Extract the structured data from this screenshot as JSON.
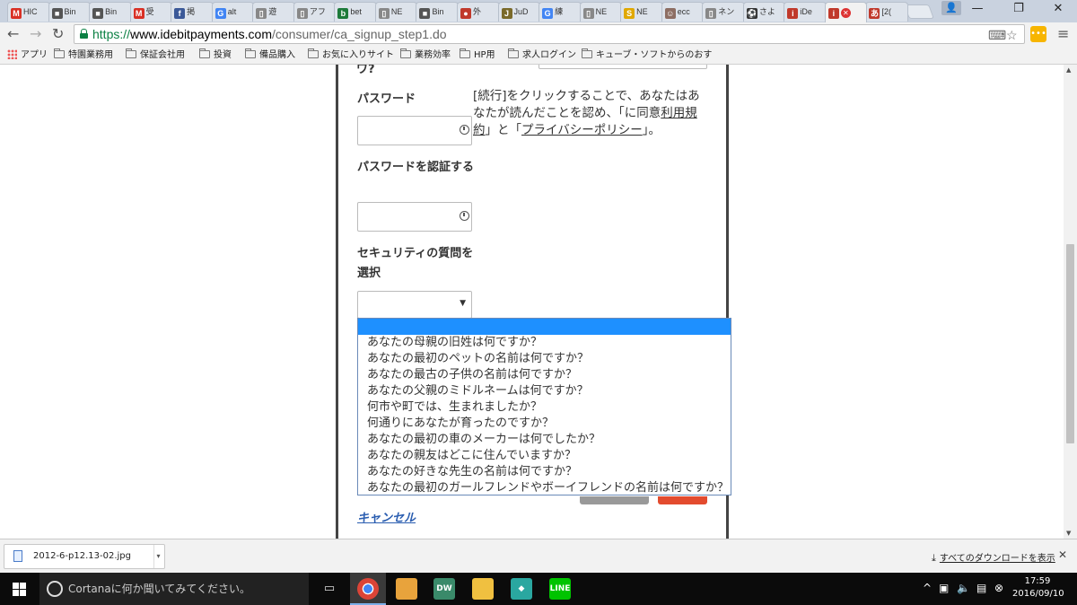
{
  "tabs": [
    {
      "label": "HIC",
      "icon": "gmail-icon",
      "color": "#d93025",
      "glyph": "M"
    },
    {
      "label": "Bin",
      "icon": "binary-icon",
      "color": "#555555",
      "glyph": "■"
    },
    {
      "label": "Bin",
      "icon": "binary-icon",
      "color": "#555555",
      "glyph": "■"
    },
    {
      "label": "受",
      "icon": "gmail-icon",
      "color": "#d93025",
      "glyph": "M"
    },
    {
      "label": "掲",
      "icon": "facebook-icon",
      "color": "#3b5998",
      "glyph": "f"
    },
    {
      "label": "alt",
      "icon": "google-icon",
      "color": "#4285f4",
      "glyph": "G"
    },
    {
      "label": "遊",
      "icon": "page-icon",
      "color": "#888888",
      "glyph": "▯"
    },
    {
      "label": "アフ",
      "icon": "page-icon",
      "color": "#888888",
      "glyph": "▯"
    },
    {
      "label": "bet",
      "icon": "bet365-icon",
      "color": "#1d7a3a",
      "glyph": "b"
    },
    {
      "label": "NE",
      "icon": "page-icon",
      "color": "#888888",
      "glyph": "▯"
    },
    {
      "label": "Bin",
      "icon": "binary-icon",
      "color": "#555555",
      "glyph": "■"
    },
    {
      "label": "外",
      "icon": "map-pin-icon",
      "color": "#c0392b",
      "glyph": "●"
    },
    {
      "label": "JuD",
      "icon": "jud-icon",
      "color": "#7a6a2a",
      "glyph": "J"
    },
    {
      "label": "練",
      "icon": "google-icon",
      "color": "#4285f4",
      "glyph": "G"
    },
    {
      "label": "NE",
      "icon": "page-icon",
      "color": "#888888",
      "glyph": "▯"
    },
    {
      "label": "NE",
      "icon": "coin-icon",
      "color": "#e0a800",
      "glyph": "S"
    },
    {
      "label": "ecc",
      "icon": "avatar-icon",
      "color": "#8d6e63",
      "glyph": "☺"
    },
    {
      "label": "ネン",
      "icon": "page-icon",
      "color": "#888888",
      "glyph": "▯"
    },
    {
      "label": "さよ",
      "icon": "soccer-icon",
      "color": "#333333",
      "glyph": "⚽"
    },
    {
      "label": "iDe",
      "icon": "idebit-icon",
      "color": "#c0392b",
      "glyph": "i"
    },
    {
      "label": "",
      "icon": "idebit-icon",
      "color": "#c0392b",
      "glyph": "i"
    },
    {
      "label": "[2(",
      "icon": "logo-icon",
      "color": "#c0392b",
      "glyph": "あ"
    }
  ],
  "window": {
    "minimize": "—",
    "restore": "❐",
    "close": "✕"
  },
  "address": {
    "scheme": "https://",
    "host": "www.idebitpayments.com",
    "path": "/consumer/ca_signup_step1.do"
  },
  "bookmarks": [
    {
      "label": "アプリ",
      "icon": "apps-icon"
    },
    {
      "label": "特園業務用",
      "icon": "folder-icon"
    },
    {
      "label": "保証会社用",
      "icon": "folder-icon"
    },
    {
      "label": "投資",
      "icon": "folder-icon"
    },
    {
      "label": "備品購入",
      "icon": "folder-icon"
    },
    {
      "label": "お気に入りサイト",
      "icon": "folder-icon"
    },
    {
      "label": "業務効率",
      "icon": "folder-icon"
    },
    {
      "label": "HP用",
      "icon": "folder-icon"
    },
    {
      "label": "求人ログイン",
      "icon": "folder-icon"
    },
    {
      "label": "キューブ・ソフトからのおす",
      "icon": "folder-icon"
    }
  ],
  "form": {
    "cut_label": "ワ?",
    "password_label": "パスワード",
    "confirm_password_label": "パスワードを認証する",
    "security_question_label": "セキュリティの質問を選択",
    "terms_text_1": "[続行]をクリックすることで、あなたはあなたが読んだことを認め、「に同意",
    "terms_link_1": "利用規約",
    "terms_text_2": "」と「",
    "terms_link_2": "プライバシーポリシー",
    "terms_text_3": "」。",
    "cancel_link": "キャンセル"
  },
  "security_questions": [
    "",
    "あなたの母親の旧姓は何ですか？",
    "あなたの最初のペットの名前は何ですか？",
    "あなたの最古の子供の名前は何ですか？",
    "あなたの父親のミドルネームは何ですか？",
    "何市や町では、生まれましたか？",
    "何通りにあなたが育ったのですか？",
    "あなたの最初の車のメーカーは何でしたか？",
    "あなたの親友はどこに住んでいますか？",
    "あなたの好きな先生の名前は何ですか？",
    "あなたの最初のガールフレンドやボーイフレンドの名前は何ですか？"
  ],
  "download": {
    "filename": "2012-6-p12.13-02.jpg",
    "show_all": "すべてのダウンロードを表示"
  },
  "taskbar": {
    "cortana_placeholder": "Cortanaに何か聞いてみてください。",
    "time": "17:59",
    "date": "2016/09/10"
  },
  "colors": {
    "selected_option": "#1e90ff",
    "cancel_link": "#2a5db0",
    "primary_button": "#e34b2e",
    "secondary_button": "#999999"
  }
}
